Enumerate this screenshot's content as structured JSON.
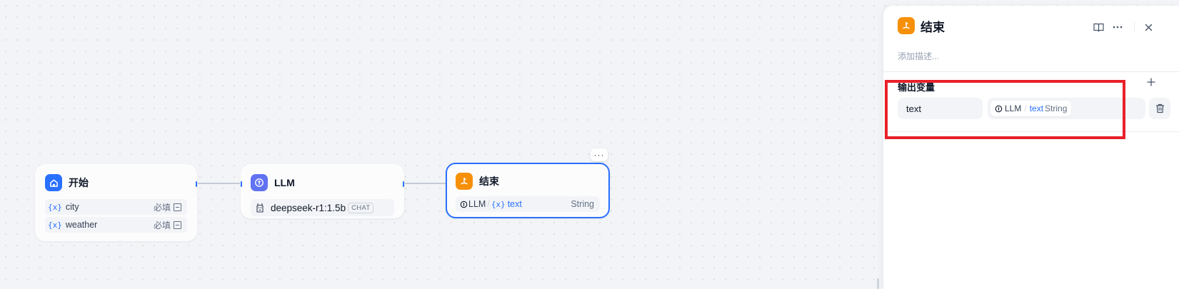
{
  "canvas": {
    "nodes": {
      "start": {
        "title": "开始",
        "variables": [
          {
            "icon_text": "{x}",
            "name": "city",
            "required_label": "必填"
          },
          {
            "icon_text": "{x}",
            "name": "weather",
            "required_label": "必填"
          }
        ]
      },
      "llm": {
        "title": "LLM",
        "model_name": "deepseek-r1:1.5b",
        "model_mode": "CHAT"
      },
      "end": {
        "title": "结束",
        "output": {
          "source": "LLM",
          "separator": "/",
          "icon_text": "{x}",
          "variable": "text",
          "type": "String"
        },
        "more_label": "···"
      }
    }
  },
  "panel": {
    "title": "结束",
    "description_placeholder": "添加描述...",
    "section_title": "输出变量",
    "output_variables": [
      {
        "name": "text",
        "source": "LLM",
        "separator": "/",
        "variable": "text",
        "type": "String"
      }
    ],
    "icons": [
      "book-icon",
      "more-icon",
      "close-icon",
      "add-icon",
      "trash-icon"
    ]
  },
  "colors": {
    "start_icon_bg": "#2970ff",
    "llm_icon_bg": "#6172f3",
    "end_icon_bg": "#f79009",
    "accent": "#2970ff",
    "highlight": "#e8202a"
  }
}
